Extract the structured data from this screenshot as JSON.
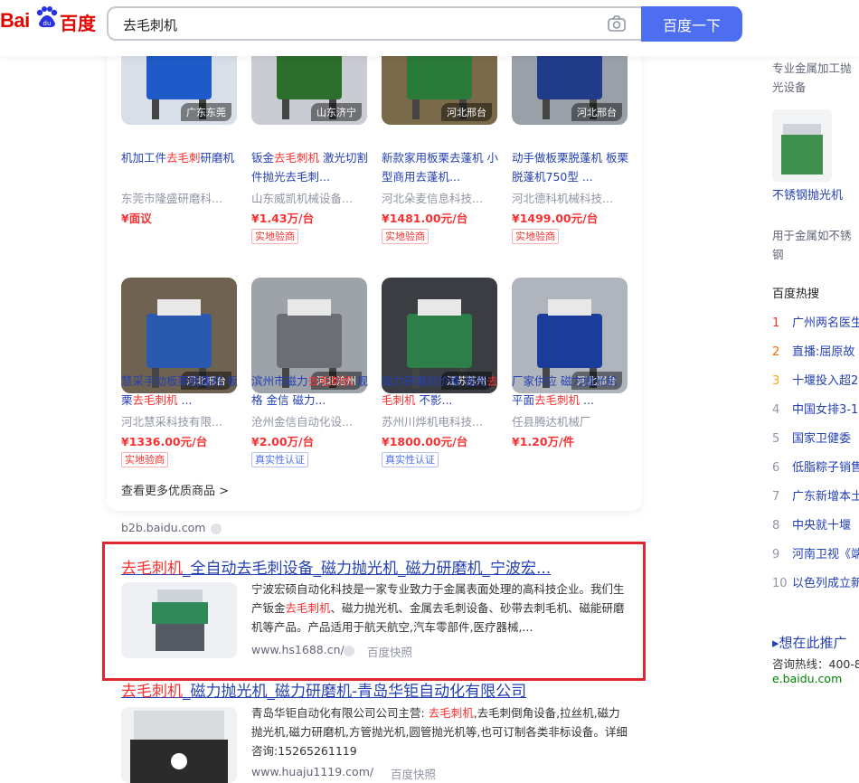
{
  "header": {
    "logo_text_left": "Bai",
    "logo_text_right": "百度",
    "search_value": "去毛刺机",
    "search_button": "百度一下"
  },
  "products": [
    {
      "title_pre": "机加工件",
      "title_hl": "去毛刺",
      "title_post": "研磨机",
      "shop": "东莞市隆盛研磨科...",
      "price": "¥面议",
      "tag": "",
      "location": "广东东莞"
    },
    {
      "title_pre": "钣金",
      "title_hl": "去毛刺机",
      "title_post": " 激光切割件抛光去毛刺...",
      "shop": "山东威凯机械设备...",
      "price": "¥1.43万/台",
      "tag": "实地验商",
      "location": "山东济宁"
    },
    {
      "title_pre": "新款家用板栗去蓬机 小型商用去蓬机...",
      "title_hl": "",
      "title_post": "",
      "shop": "河北朵麦信息科技...",
      "price": "¥1481.00元/台",
      "tag": "实地验商",
      "location": "河北邢台"
    },
    {
      "title_pre": "动手做板栗脱蓬机 板栗脱蓬机750型 ...",
      "title_hl": "",
      "title_post": "",
      "shop": "河北德科机械科技...",
      "price": "¥1499.00元/台",
      "tag": "实地验商",
      "location": "河北邢台"
    },
    {
      "title_pre": "慧采手动板栗脱蓬机 板栗",
      "title_hl": "去毛刺机",
      "title_post": " ...",
      "shop": "河北慧采科技有限...",
      "price": "¥1336.00元/台",
      "tag": "实地验商",
      "location": "河北邢台"
    },
    {
      "title_pre": "滨州市磁力",
      "title_hl": "去毛刺机",
      "title_post": " 规格 金信 磁力...",
      "shop": "沧州金信自动化设...",
      "price": "¥2.00万/台",
      "tag": "真实性认证",
      "location": "河北沧州"
    },
    {
      "title_pre": "磁力研磨机价格 抛光",
      "title_hl": "去毛刺机",
      "title_post": " 不影...",
      "shop": "苏州川烨机电科技...",
      "price": "¥1800.00元/台",
      "tag": "真实性认证",
      "location": "江苏苏州"
    },
    {
      "title_pre": "厂家供应 磁力抛光机 平面",
      "title_hl": "去毛刺机",
      "title_post": " ...",
      "shop": "任县腾达机械厂",
      "price": "¥1.20万/件",
      "tag": "",
      "location": "河北邢台"
    }
  ],
  "more_products": "查看更多优质商品 >",
  "source_b2b": "b2b.baidu.com",
  "result1": {
    "title_hl": "去毛刺机",
    "title_rest": "_全自动去毛刺设备_磁力抛光机_磁力研磨机_宁波宏...",
    "desc_1": "宁波宏硕自动化科技是一家专业致力于金属表面处理的高科技企业。我们生产钣金",
    "desc_hl": "去毛刺机",
    "desc_2": "、磁力抛光机、金属去毛刺设备、砂带去刺毛机、磁能研磨机等产品。产品适用于航天航空,汽车零部件,医疗器械,...",
    "url": "www.hs1688.cn/",
    "snapshot": "百度快照"
  },
  "result2": {
    "title_hl": "去毛刺机",
    "title_rest": "_磁力抛光机_磁力研磨机-青岛华钜自动化有限公司",
    "desc_1": "青岛华钜自动化有限公司公司主营: ",
    "desc_hl": "去毛刺机",
    "desc_2": ",去毛刺倒角设备,拉丝机,磁力抛光机,磁力研磨机,方管抛光机,圆管抛光机等,也可订制各类非标设备。详细咨询:15265261119",
    "url": "www.huaju1119.com/",
    "snapshot": "百度快照"
  },
  "right": {
    "top_text": "专业金属加工抛光设备",
    "product_title": "不锈钢抛光机",
    "product_desc": "用于金属如不锈钢",
    "hot_title": "百度热搜",
    "hot_items": [
      {
        "num": "1",
        "text": "广州两名医生",
        "color": "#f73131"
      },
      {
        "num": "2",
        "text": "直播:屈原故",
        "color": "#ff6600"
      },
      {
        "num": "3",
        "text": "十堰投入超2",
        "color": "#faa90e"
      },
      {
        "num": "4",
        "text": "中国女排3-1",
        "color": "#9195a3"
      },
      {
        "num": "5",
        "text": "国家卫健委",
        "color": "#9195a3"
      },
      {
        "num": "6",
        "text": "低脂粽子销售",
        "color": "#9195a3"
      },
      {
        "num": "7",
        "text": "广东新增本土",
        "color": "#9195a3"
      },
      {
        "num": "8",
        "text": "中央就十堰",
        "color": "#9195a3"
      },
      {
        "num": "9",
        "text": "河南卫视《端",
        "color": "#9195a3"
      },
      {
        "num": "10",
        "text": "以色列成立新",
        "color": "#9195a3"
      }
    ],
    "ad_title": "▸想在此推广",
    "ad_phone": "咨询热线：400-8",
    "ad_url": "e.baidu.com"
  }
}
